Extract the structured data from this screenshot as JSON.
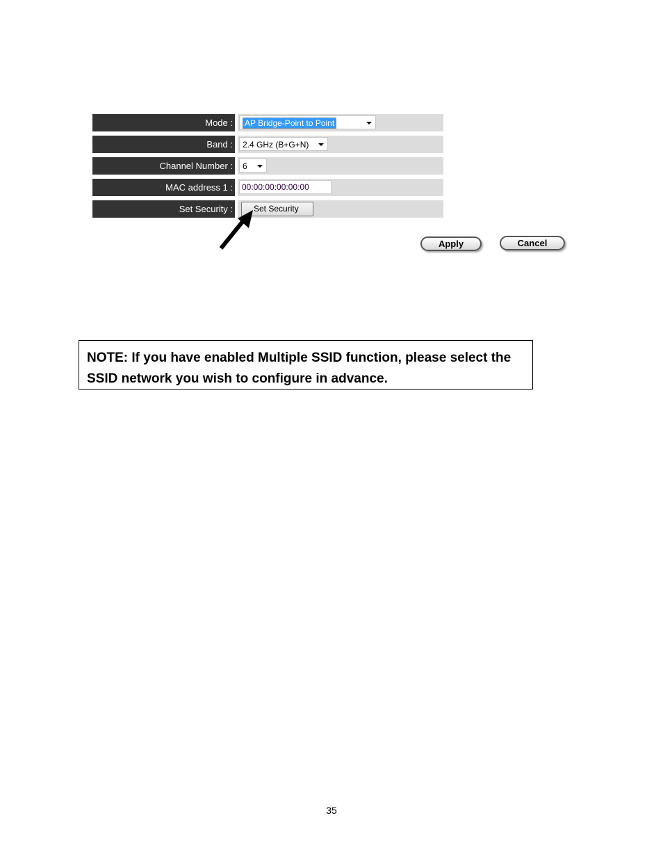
{
  "form": {
    "rows": [
      {
        "label": "Mode :",
        "type": "select",
        "value": "AP Bridge-Point to Point"
      },
      {
        "label": "Band :",
        "type": "select",
        "value": "2.4 GHz (B+G+N)"
      },
      {
        "label": "Channel Number :",
        "type": "select",
        "value": "6"
      },
      {
        "label": "MAC address 1 :",
        "type": "input",
        "value": "00:00:00:00:00:00"
      },
      {
        "label": "Set Security :",
        "type": "button",
        "value": "Set Security"
      }
    ],
    "apply_label": "Apply",
    "cancel_label": "Cancel"
  },
  "note": {
    "text": "NOTE: If you have enabled Multiple SSID function, please select the SSID network you wish to configure in advance."
  },
  "page_number": "35"
}
